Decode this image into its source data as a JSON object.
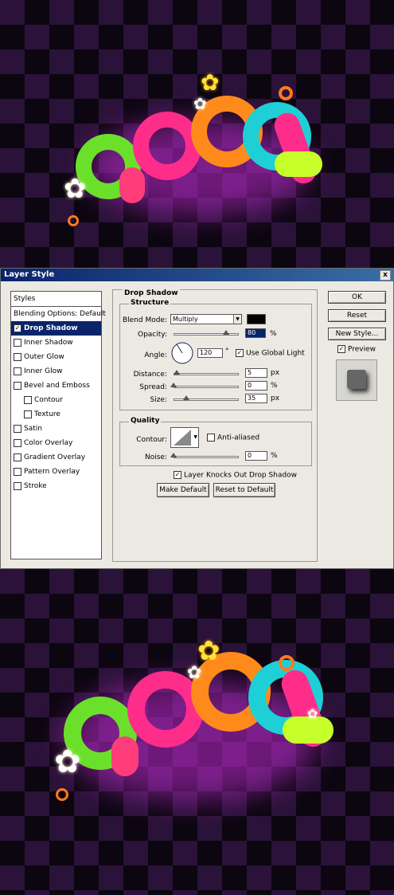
{
  "dialog": {
    "title": "Layer Style",
    "close_glyph": "x",
    "styles_header": "Styles",
    "blending_options": "Blending Options: Default",
    "items": [
      {
        "label": "Drop Shadow",
        "checked": true,
        "selected": true
      },
      {
        "label": "Inner Shadow",
        "checked": false
      },
      {
        "label": "Outer Glow",
        "checked": false
      },
      {
        "label": "Inner Glow",
        "checked": false
      },
      {
        "label": "Bevel and Emboss",
        "checked": false
      },
      {
        "label": "Contour",
        "checked": false,
        "sub": true
      },
      {
        "label": "Texture",
        "checked": false,
        "sub": true
      },
      {
        "label": "Satin",
        "checked": false
      },
      {
        "label": "Color Overlay",
        "checked": false
      },
      {
        "label": "Gradient Overlay",
        "checked": false
      },
      {
        "label": "Pattern Overlay",
        "checked": false
      },
      {
        "label": "Stroke",
        "checked": false
      }
    ],
    "check_glyph": "✓",
    "drop_shadow": {
      "title": "Drop Shadow",
      "structure": "Structure",
      "blend_mode_label": "Blend Mode:",
      "blend_mode_value": "Multiply",
      "blend_color": "#000000",
      "opacity_label": "Opacity:",
      "opacity_value": "80",
      "opacity_fraction": 0.8,
      "percent": "%",
      "angle_label": "Angle:",
      "angle_value": "120",
      "degree": "°",
      "use_global_light": "Use Global Light",
      "use_global_light_checked": true,
      "distance_label": "Distance:",
      "distance_value": "5",
      "spread_label": "Spread:",
      "spread_value": "0",
      "size_label": "Size:",
      "size_value": "35",
      "px": "px",
      "quality": "Quality",
      "contour_label": "Contour:",
      "anti_aliased": "Anti-aliased",
      "noise_label": "Noise:",
      "noise_value": "0",
      "knockout": "Layer Knocks Out Drop Shadow",
      "make_default": "Make Default",
      "reset_default": "Reset to Default"
    },
    "ok": "OK",
    "reset": "Reset",
    "new_style": "New Style...",
    "preview": "Preview"
  }
}
